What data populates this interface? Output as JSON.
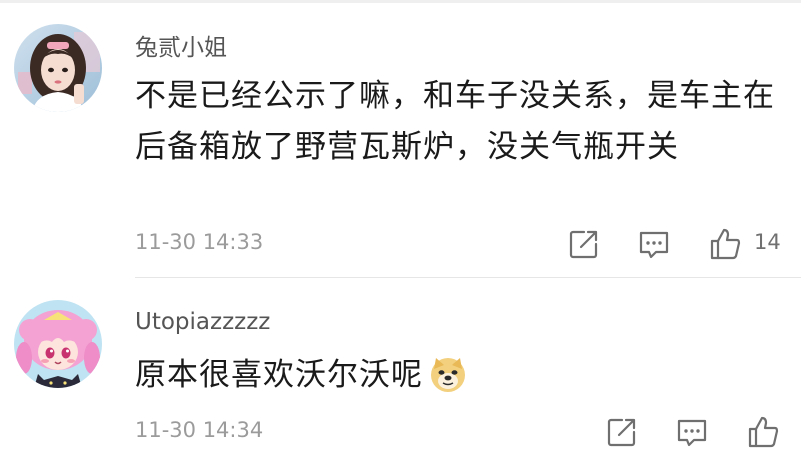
{
  "comments": [
    {
      "username": "兔贰小姐",
      "text": "不是已经公示了嘛，和车子没关系，是车主在后备箱放了野营瓦斯炉，没关气瓶开关",
      "timestamp": "11-30 14:33",
      "like_count": "14",
      "avatar_icon": "avatar-girl-photo",
      "actions": [
        "share-icon",
        "reply-icon",
        "like-icon"
      ]
    },
    {
      "username": "Utopiazzzzz",
      "text": "原本很喜欢沃尔沃呢",
      "emoji": "doge-emoji",
      "timestamp": "11-30 14:34",
      "like_count": "",
      "avatar_icon": "avatar-anime-girl",
      "actions": [
        "share-icon",
        "reply-icon",
        "like-icon"
      ]
    }
  ],
  "colors": {
    "username": "#555555",
    "content": "#1a1a1a",
    "meta": "#9b9b9b",
    "icon_stroke": "#6f6f6f",
    "divider": "#e6e6e6"
  }
}
